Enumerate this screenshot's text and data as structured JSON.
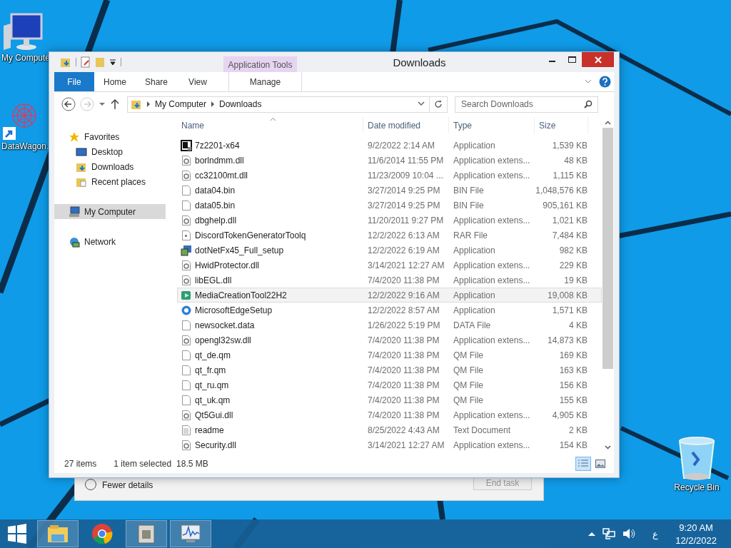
{
  "desktop": {
    "icons": [
      {
        "label": "My Compute",
        "kind": "computer"
      },
      {
        "label": "DataWagon.",
        "kind": "shortcut"
      },
      {
        "label": "Recycle Bin",
        "kind": "recycle"
      }
    ]
  },
  "background_window": {
    "details_toggle": "Fewer details",
    "button": "End task"
  },
  "window": {
    "title": "Downloads",
    "context_group": "Application Tools",
    "ribbon_tabs": [
      {
        "label": "File",
        "kind": "file",
        "selected": false
      },
      {
        "label": "Home",
        "kind": "tab",
        "selected": false
      },
      {
        "label": "Share",
        "kind": "tab",
        "selected": false
      },
      {
        "label": "View",
        "kind": "tab",
        "selected": false
      },
      {
        "label": "Manage",
        "kind": "contextual",
        "selected": false
      }
    ],
    "breadcrumb": [
      "My Computer",
      "Downloads"
    ],
    "search": {
      "placeholder": "Search Downloads"
    },
    "nav": [
      {
        "label": "Favorites",
        "kind": "star",
        "selected": false,
        "children": [
          {
            "label": "Desktop",
            "kind": "desktop",
            "selected": false
          },
          {
            "label": "Downloads",
            "kind": "downloads",
            "selected": false
          },
          {
            "label": "Recent places",
            "kind": "recent",
            "selected": false
          }
        ]
      },
      {
        "label": "My Computer",
        "kind": "computer",
        "selected": true
      },
      {
        "label": "Network",
        "kind": "network",
        "selected": false
      }
    ],
    "table": {
      "columns": [
        {
          "label": "Name",
          "sorted": true
        },
        {
          "label": "Date modified",
          "sorted": false
        },
        {
          "label": "Type",
          "sorted": false
        },
        {
          "label": "Size",
          "sorted": false
        }
      ],
      "rows": [
        {
          "name": "7z2201-x64",
          "date": "9/2/2022 2:14 AM",
          "type": "Application",
          "size": "1,539 KB",
          "kind": "sevenzip",
          "selected": false
        },
        {
          "name": "borlndmm.dll",
          "date": "11/6/2014 11:55 PM",
          "type": "Application extens...",
          "size": "48 KB",
          "kind": "dll",
          "selected": false
        },
        {
          "name": "cc32100mt.dll",
          "date": "11/23/2009 10:04 ...",
          "type": "Application extens...",
          "size": "1,115 KB",
          "kind": "dll",
          "selected": false
        },
        {
          "name": "data04.bin",
          "date": "3/27/2014 9:25 PM",
          "type": "BIN File",
          "size": "1,048,576 KB",
          "kind": "blank",
          "selected": false
        },
        {
          "name": "data05.bin",
          "date": "3/27/2014 9:25 PM",
          "type": "BIN File",
          "size": "905,161 KB",
          "kind": "blank",
          "selected": false
        },
        {
          "name": "dbghelp.dll",
          "date": "11/20/2011 9:27 PM",
          "type": "Application extens...",
          "size": "1,021 KB",
          "kind": "dll",
          "selected": false
        },
        {
          "name": "DiscordTokenGeneratorToolq",
          "date": "12/2/2022 6:13 AM",
          "type": "RAR File",
          "size": "7,484 KB",
          "kind": "rar",
          "selected": false
        },
        {
          "name": "dotNetFx45_Full_setup",
          "date": "12/2/2022 6:19 AM",
          "type": "Application",
          "size": "982 KB",
          "kind": "setup",
          "selected": false
        },
        {
          "name": "HwidProtector.dll",
          "date": "3/14/2021 12:27 AM",
          "type": "Application extens...",
          "size": "229 KB",
          "kind": "dll",
          "selected": false
        },
        {
          "name": "libEGL.dll",
          "date": "7/4/2020 11:38 PM",
          "type": "Application extens...",
          "size": "19 KB",
          "kind": "dll",
          "selected": false
        },
        {
          "name": "MediaCreationTool22H2",
          "date": "12/2/2022 9:16 AM",
          "type": "Application",
          "size": "19,008 KB",
          "kind": "media",
          "selected": true
        },
        {
          "name": "MicrosoftEdgeSetup",
          "date": "12/2/2022 8:57 AM",
          "type": "Application",
          "size": "1,571 KB",
          "kind": "edge",
          "selected": false
        },
        {
          "name": "newsocket.data",
          "date": "1/26/2022 5:19 PM",
          "type": "DATA File",
          "size": "4 KB",
          "kind": "blank",
          "selected": false
        },
        {
          "name": "opengl32sw.dll",
          "date": "7/4/2020 11:38 PM",
          "type": "Application extens...",
          "size": "14,873 KB",
          "kind": "dll",
          "selected": false
        },
        {
          "name": "qt_de.qm",
          "date": "7/4/2020 11:38 PM",
          "type": "QM File",
          "size": "169 KB",
          "kind": "blank",
          "selected": false
        },
        {
          "name": "qt_fr.qm",
          "date": "7/4/2020 11:38 PM",
          "type": "QM File",
          "size": "163 KB",
          "kind": "blank",
          "selected": false
        },
        {
          "name": "qt_ru.qm",
          "date": "7/4/2020 11:38 PM",
          "type": "QM File",
          "size": "156 KB",
          "kind": "blank",
          "selected": false
        },
        {
          "name": "qt_uk.qm",
          "date": "7/4/2020 11:38 PM",
          "type": "QM File",
          "size": "155 KB",
          "kind": "blank",
          "selected": false
        },
        {
          "name": "Qt5Gui.dll",
          "date": "7/4/2020 11:38 PM",
          "type": "Application extens...",
          "size": "4,905 KB",
          "kind": "dll",
          "selected": false
        },
        {
          "name": "readme",
          "date": "8/25/2022 4:43 AM",
          "type": "Text Document",
          "size": "2 KB",
          "kind": "text",
          "selected": false
        },
        {
          "name": "Security.dll",
          "date": "3/14/2021 12:27 AM",
          "type": "Application extens...",
          "size": "154 KB",
          "kind": "dll",
          "selected": false
        }
      ]
    },
    "status_bar": {
      "count": "27 items",
      "selection": "1 item selected",
      "selection_size": "18.5 MB"
    },
    "view_buttons": [
      {
        "kind": "details",
        "selected": true
      },
      {
        "kind": "thumbnails",
        "selected": false
      }
    ]
  },
  "taskbar": {
    "apps": [
      {
        "kind": "explorer",
        "open": true
      },
      {
        "kind": "chrome",
        "open": false
      },
      {
        "kind": "archive",
        "open": true
      },
      {
        "kind": "monitor",
        "open": true
      }
    ],
    "tray": {
      "language": "ع",
      "time": "9:20 AM",
      "date": "12/2/2022"
    }
  }
}
